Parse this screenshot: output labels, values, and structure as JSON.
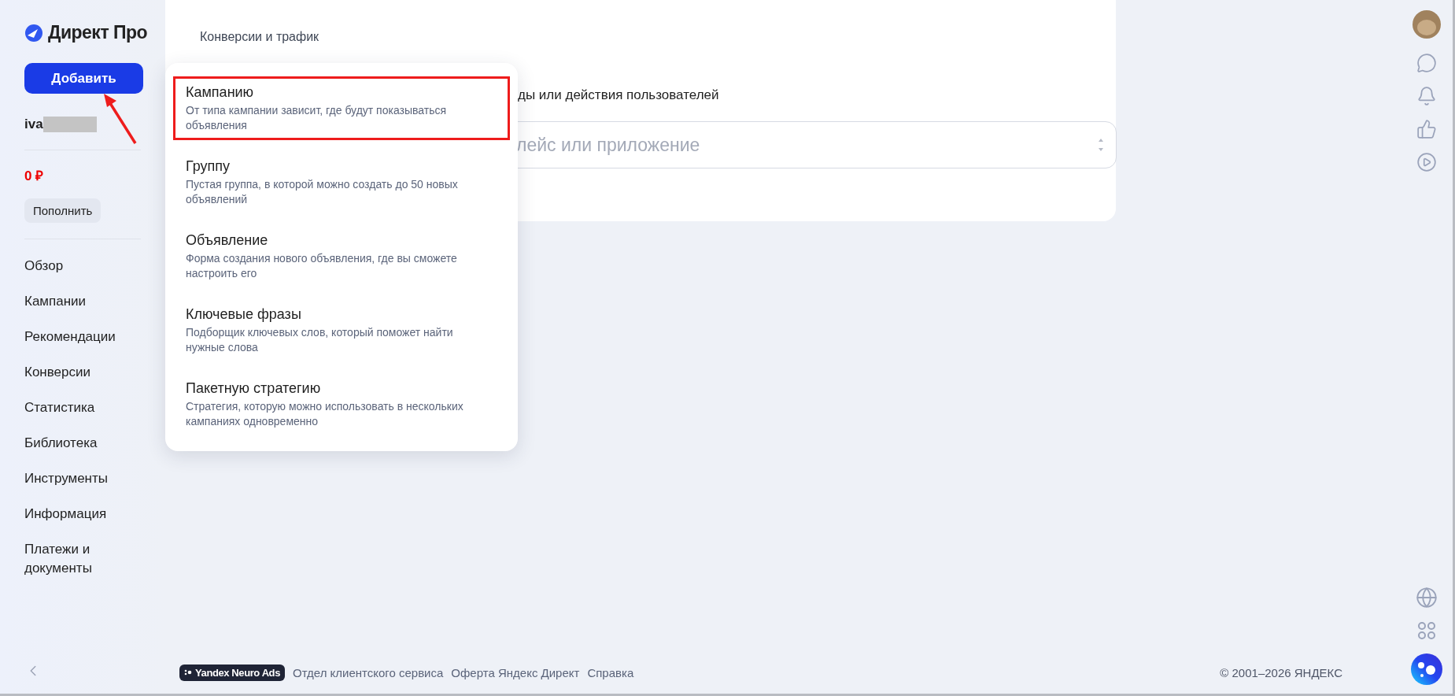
{
  "sidebar": {
    "logo": "Директ Про",
    "add_button": "Добавить",
    "username": "iva",
    "balance": "0 ₽",
    "top_up_button": "Пополнить",
    "nav": [
      {
        "label": "Обзор"
      },
      {
        "label": "Кампании"
      },
      {
        "label": "Рекомендации"
      },
      {
        "label": "Конверсии"
      },
      {
        "label": "Статистика"
      },
      {
        "label": "Библиотека"
      },
      {
        "label": "Инструменты"
      },
      {
        "label": "Информация"
      },
      {
        "label": "Платежи и документы"
      }
    ]
  },
  "main": {
    "breadcrumb": "Конверсии и трафик",
    "subtitle": "ды или действия пользователей",
    "field": {
      "placeholder": "лейс или приложение"
    }
  },
  "menu": {
    "items": [
      {
        "title": "Кампанию",
        "description": "От типа кампании зависит, где будут показываться объявления",
        "highlighted": true
      },
      {
        "title": "Группу",
        "description": "Пустая группа, в которой можно создать до 50 новых объявлений",
        "highlighted": false
      },
      {
        "title": "Объявление",
        "description": "Форма создания нового объявления, где вы сможете настроить его",
        "highlighted": false
      },
      {
        "title": "Ключевые фразы",
        "description": "Подборщик ключевых слов, который поможет найти нужные слова",
        "highlighted": false
      },
      {
        "title": "Пакетную стратегию",
        "description": "Стратегия, которую можно использовать в нескольких кампаниях одновременно",
        "highlighted": false
      }
    ]
  },
  "footer": {
    "badge": "Yandex Neuro Ads",
    "links": [
      "Отдел клиентского сервиса",
      "Оферта Яндекс Директ",
      "Справка"
    ],
    "copyright": "© 2001–2026 ЯНДЕКС"
  }
}
